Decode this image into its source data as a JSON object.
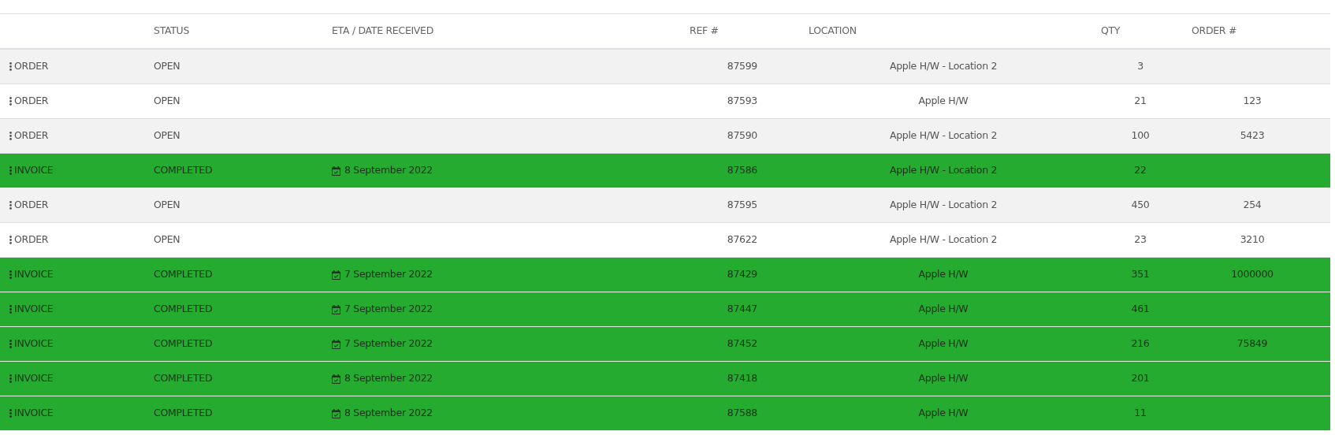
{
  "table": {
    "columns": [
      "",
      "STATUS",
      "ETA / DATE RECEIVED",
      "REF #",
      "LOCATION",
      "QTY",
      "ORDER #"
    ],
    "rows": [
      {
        "kind": "order",
        "type": "ORDER",
        "status": "OPEN",
        "ref": "87599",
        "location": "Apple H/W - Location 2",
        "qty": "3"
      },
      {
        "kind": "order",
        "type": "ORDER",
        "status": "OPEN",
        "ref": "87593",
        "location": "Apple H/W",
        "qty": "21",
        "order": "123"
      },
      {
        "kind": "order",
        "type": "ORDER",
        "status": "OPEN",
        "ref": "87590",
        "location": "Apple H/W - Location 2",
        "qty": "100",
        "order": "5423"
      },
      {
        "kind": "invoice",
        "type": "INVOICE",
        "status": "COMPLETED",
        "date": "8 September 2022",
        "ref": "87586",
        "location": "Apple H/W - Location 2",
        "qty": "22"
      },
      {
        "kind": "order",
        "type": "ORDER",
        "status": "OPEN",
        "ref": "87595",
        "location": "Apple H/W - Location 2",
        "qty": "450",
        "order": "254"
      },
      {
        "kind": "order",
        "type": "ORDER",
        "status": "OPEN",
        "ref": "87622",
        "location": "Apple H/W - Location 2",
        "qty": "23",
        "order": "3210"
      },
      {
        "kind": "invoice",
        "type": "INVOICE",
        "status": "COMPLETED",
        "date": "7 September 2022",
        "ref": "87429",
        "location": "Apple H/W",
        "qty": "351",
        "order": "1000000"
      },
      {
        "kind": "invoice",
        "type": "INVOICE",
        "status": "COMPLETED",
        "date": "7 September 2022",
        "ref": "87447",
        "location": "Apple H/W",
        "qty": "461"
      },
      {
        "kind": "invoice",
        "type": "INVOICE",
        "status": "COMPLETED",
        "date": "7 September 2022",
        "ref": "87452",
        "location": "Apple H/W",
        "qty": "216",
        "order": "75849"
      },
      {
        "kind": "invoice",
        "type": "INVOICE",
        "status": "COMPLETED",
        "date": "8 September 2022",
        "ref": "87418",
        "location": "Apple H/W",
        "qty": "201"
      },
      {
        "kind": "invoice",
        "type": "INVOICE",
        "status": "COMPLETED",
        "date": "8 September 2022",
        "ref": "87588",
        "location": "Apple H/W",
        "qty": "11"
      }
    ]
  }
}
